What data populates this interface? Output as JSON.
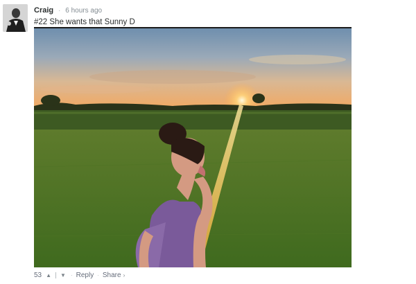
{
  "comment": {
    "author": "Craig",
    "timestamp": "6 hours ago",
    "text": "#22 She wants that Sunny D",
    "votes": "53",
    "reply_label": "Reply",
    "share_label": "Share"
  },
  "icons": {
    "avatar": "avatar-photo",
    "upvote": "chevron-up-icon",
    "downvote": "chevron-down-icon",
    "share": "chevron-right-icon"
  },
  "colors": {
    "text": "#2a2e2e",
    "meta": "#848d93",
    "footer": "#656c7a",
    "image_border": "#1c1c1c"
  }
}
